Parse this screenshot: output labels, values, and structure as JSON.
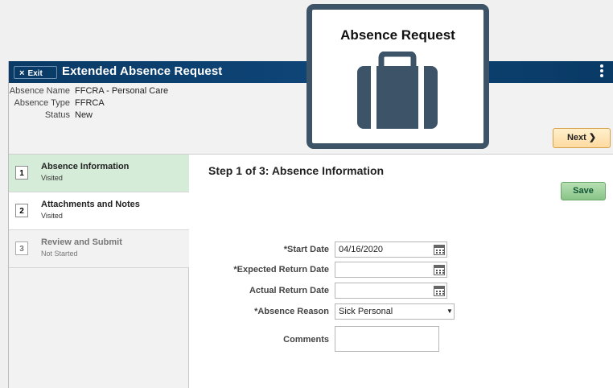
{
  "banner": {
    "exit_label": "Exit",
    "title": "Extended Absence Request"
  },
  "header": {
    "absence_name_label": "Absence Name",
    "absence_name_value": "FFCRA - Personal Care",
    "absence_type_label": "Absence Type",
    "absence_type_value": "FFRCA",
    "status_label": "Status",
    "status_value": "New",
    "next_label": "Next"
  },
  "steps": [
    {
      "number": "1",
      "title": "Absence Information",
      "status": "Visited"
    },
    {
      "number": "2",
      "title": "Attachments and Notes",
      "status": "Visited"
    },
    {
      "number": "3",
      "title": "Review and Submit",
      "status": "Not Started"
    }
  ],
  "content": {
    "heading": "Step 1 of 3: Absence Information",
    "save_label": "Save"
  },
  "form": {
    "start_date_label": "*Start Date",
    "start_date_value": "04/16/2020",
    "expected_return_label": "*Expected Return Date",
    "expected_return_value": "",
    "actual_return_label": "Actual Return Date",
    "actual_return_value": "",
    "absence_reason_label": "*Absence Reason",
    "absence_reason_value": "Sick Personal",
    "comments_label": "Comments",
    "comments_value": ""
  },
  "overlay": {
    "title": "Absence Request",
    "icon": "suitcase-icon"
  },
  "colors": {
    "banner": "#0b3d6b",
    "active_step": "#d5ecd8",
    "next_button": "#ffe7b8",
    "save_button": "#9ad09a",
    "overlay_border": "#3d5367"
  }
}
